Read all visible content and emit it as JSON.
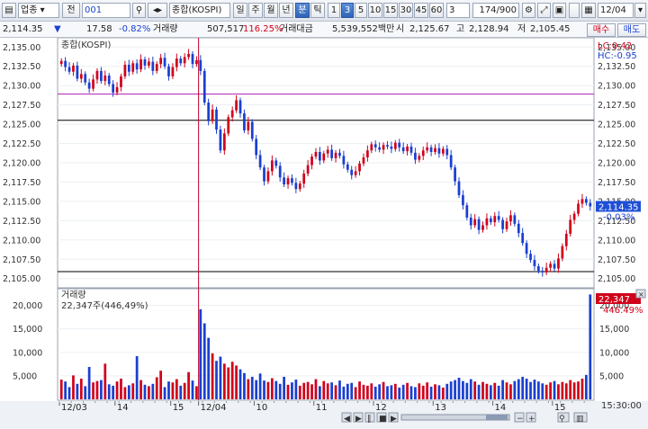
{
  "toolbar": {
    "market": "업종",
    "scope": "전",
    "code": "001",
    "search": "종합(KOSPI)",
    "periods": [
      "일",
      "주",
      "월",
      "년",
      "분",
      "틱"
    ],
    "selected_period": "분",
    "intervals": [
      "1",
      "3",
      "5",
      "10",
      "15",
      "30",
      "45",
      "60"
    ],
    "selected_interval": "3",
    "interval_value": "3",
    "count": "174/900",
    "date": "12/04"
  },
  "info": {
    "price": "2,114.35",
    "change": "17.58",
    "change_pct": "-0.82%",
    "volume_label": "거래량",
    "volume": "507,517",
    "volume_ratio": "116.25%",
    "amount_label": "거래대금",
    "amount": "5,539,552백만",
    "open_label": "시",
    "open": "2,125.67",
    "high_label": "고",
    "high": "2,128.94",
    "low_label": "저",
    "low": "2,105.45",
    "buy": "매수",
    "sell": "매도"
  },
  "chart_data": [
    {
      "type": "candlestick",
      "title": "종합(KOSPI)",
      "ylim": [
        2104.5,
        2135.5
      ],
      "yticks": [
        "2,135.00",
        "2,132.50",
        "2,130.00",
        "2,127.50",
        "2,125.00",
        "2,122.50",
        "2,120.00",
        "2,117.50",
        "2,115.00",
        "2,112.50",
        "2,110.00",
        "2,107.50",
        "2,105.00"
      ],
      "lc": "LC:0.42",
      "hc": "HC:-0.95",
      "current_price": "2,114.35",
      "current_change": "-0.03%",
      "hlines": [
        {
          "value": 2128.9,
          "color": "#b020b0"
        },
        {
          "value": 2125.5,
          "color": "#000000"
        },
        {
          "value": 2105.9,
          "color": "#000000"
        }
      ],
      "closes": [
        2133.2,
        2132.4,
        2131.8,
        2132.6,
        2130.9,
        2131.5,
        2130.4,
        2129.6,
        2130.8,
        2131.9,
        2130.6,
        2131.3,
        2130.2,
        2129.1,
        2129.8,
        2131.2,
        2132.7,
        2131.8,
        2132.9,
        2132.1,
        2133.4,
        2132.6,
        2133.1,
        2131.9,
        2132.8,
        2133.6,
        2132.5,
        2131.2,
        2132.4,
        2133.5,
        2132.9,
        2133.7,
        2134.1,
        2132.8,
        2133.3,
        2131.9,
        2127.8,
        2125.4,
        2126.9,
        2124.3,
        2121.6,
        2123.8,
        2125.9,
        2126.8,
        2128.1,
        2126.4,
        2124.2,
        2125.3,
        2123.1,
        2121.0,
        2119.4,
        2117.6,
        2118.9,
        2120.3,
        2119.6,
        2118.1,
        2117.2,
        2118.0,
        2117.4,
        2116.6,
        2117.3,
        2118.6,
        2119.7,
        2120.8,
        2121.4,
        2120.3,
        2121.2,
        2121.7,
        2120.6,
        2121.3,
        2120.9,
        2119.8,
        2119.1,
        2118.4,
        2118.9,
        2119.9,
        2120.7,
        2121.6,
        2122.4,
        2122.0,
        2121.7,
        2122.3,
        2122.1,
        2121.8,
        2122.6,
        2122.0,
        2121.5,
        2122.1,
        2121.3,
        2120.4,
        2120.9,
        2121.6,
        2122.0,
        2121.4,
        2121.9,
        2121.2,
        2121.8,
        2121.0,
        2119.4,
        2117.6,
        2115.8,
        2114.5,
        2112.9,
        2111.9,
        2112.7,
        2111.3,
        2111.9,
        2112.8,
        2112.3,
        2113.1,
        2112.6,
        2111.4,
        2112.4,
        2113.2,
        2112.1,
        2110.9,
        2109.6,
        2108.2,
        2107.4,
        2106.6,
        2106.0,
        2105.8,
        2106.4,
        2106.9,
        2106.3,
        2107.6,
        2109.2,
        2110.8,
        2112.6,
        2113.4,
        2114.7,
        2115.3,
        2114.8,
        2114.35
      ],
      "volume": {
        "label": "거래량",
        "summary": "22,347주(446,49%)",
        "current": "22,347",
        "current_pct": "446.49%",
        "ylim": [
          0,
          23000
        ],
        "yticks": [
          "20,000",
          "15,000",
          "10,000",
          "5,000"
        ],
        "values": [
          4200,
          3800,
          2600,
          5100,
          3300,
          4400,
          2800,
          6900,
          3600,
          3900,
          4100,
          7600,
          3200,
          2900,
          3800,
          4400,
          2600,
          3000,
          3400,
          9200,
          4100,
          3100,
          2800,
          3300,
          4700,
          6100,
          2600,
          3800,
          3600,
          4300,
          2900,
          3500,
          5800,
          4000,
          2800,
          19200,
          16200,
          13100,
          9800,
          8200,
          9100,
          7600,
          6800,
          8000,
          7200,
          6400,
          5600,
          4300,
          4800,
          4100,
          5500,
          4000,
          3700,
          4500,
          3900,
          3300,
          4800,
          3100,
          3600,
          4200,
          2900,
          3500,
          3700,
          3200,
          4300,
          2800,
          3900,
          3400,
          3600,
          3000,
          4000,
          2700,
          3300,
          3500,
          2600,
          3800,
          3100,
          2900,
          3400,
          2700,
          3200,
          3700,
          2800,
          3000,
          3300,
          2500,
          3100,
          3500,
          2800,
          2600,
          3400,
          2900,
          3600,
          2700,
          3200,
          3000,
          2500,
          3300,
          3800,
          4100,
          4600,
          3900,
          3500,
          4300,
          3800,
          3100,
          3700,
          3300,
          3000,
          3500,
          2900,
          4100,
          3600,
          3200,
          3900,
          4300,
          4800,
          4400,
          3700,
          4200,
          3800,
          3400,
          3100,
          3600,
          3900,
          3200,
          3700,
          3400,
          4100,
          3600,
          3800,
          4400,
          5200,
          22347
        ]
      },
      "xticks": [
        {
          "label": "12/03",
          "index": 0
        },
        {
          "label": "14",
          "index": 14
        },
        {
          "label": "15",
          "index": 28
        },
        {
          "label": "12/04",
          "index": 35
        },
        {
          "label": "10",
          "index": 49
        },
        {
          "label": "11",
          "index": 64
        },
        {
          "label": "12",
          "index": 79
        },
        {
          "label": "13",
          "index": 94
        },
        {
          "label": "14",
          "index": 109
        },
        {
          "label": "15",
          "index": 124
        }
      ],
      "time_label": "15:30:00",
      "split_index": 35
    }
  ]
}
